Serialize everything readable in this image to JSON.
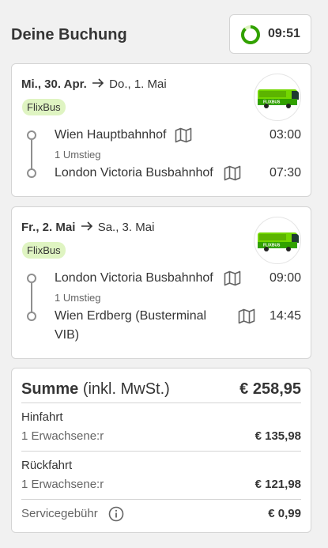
{
  "header": {
    "title": "Deine Buchung",
    "timer": "09:51",
    "timer_progress": 0.88
  },
  "trips": [
    {
      "date_from": "Mi., 30. Apr.",
      "date_to": "Do., 1. Mai",
      "brand": "FlixBus",
      "from_station": "Wien Hauptbahnhof",
      "transfers": "1 Umstieg",
      "to_station": "London Victoria Busbahnhof",
      "dep_time": "03:00",
      "arr_time": "07:30"
    },
    {
      "date_from": "Fr., 2. Mai",
      "date_to": "Sa., 3. Mai",
      "brand": "FlixBus",
      "from_station": "London Victoria Busbahnhof",
      "transfers": "1 Umstieg",
      "to_station": "Wien Erdberg (Busterminal VIB)",
      "dep_time": "09:00",
      "arr_time": "14:45"
    }
  ],
  "summary": {
    "title_bold": "Summe",
    "title_rest": "(inkl. MwSt.)",
    "total": "€ 258,95",
    "lines": [
      {
        "label": "Hinfahrt",
        "sub": "1 Erwachsene:r",
        "amount": "€ 135,98"
      },
      {
        "label": "Rückfahrt",
        "sub": "1 Erwachsene:r",
        "amount": "€ 121,98"
      }
    ],
    "service_fee_label": "Servicegebühr",
    "service_fee_amount": "€ 0,99"
  },
  "colors": {
    "accent_green": "#31a100",
    "badge_bg": "#dff4c2",
    "text": "#353535"
  }
}
